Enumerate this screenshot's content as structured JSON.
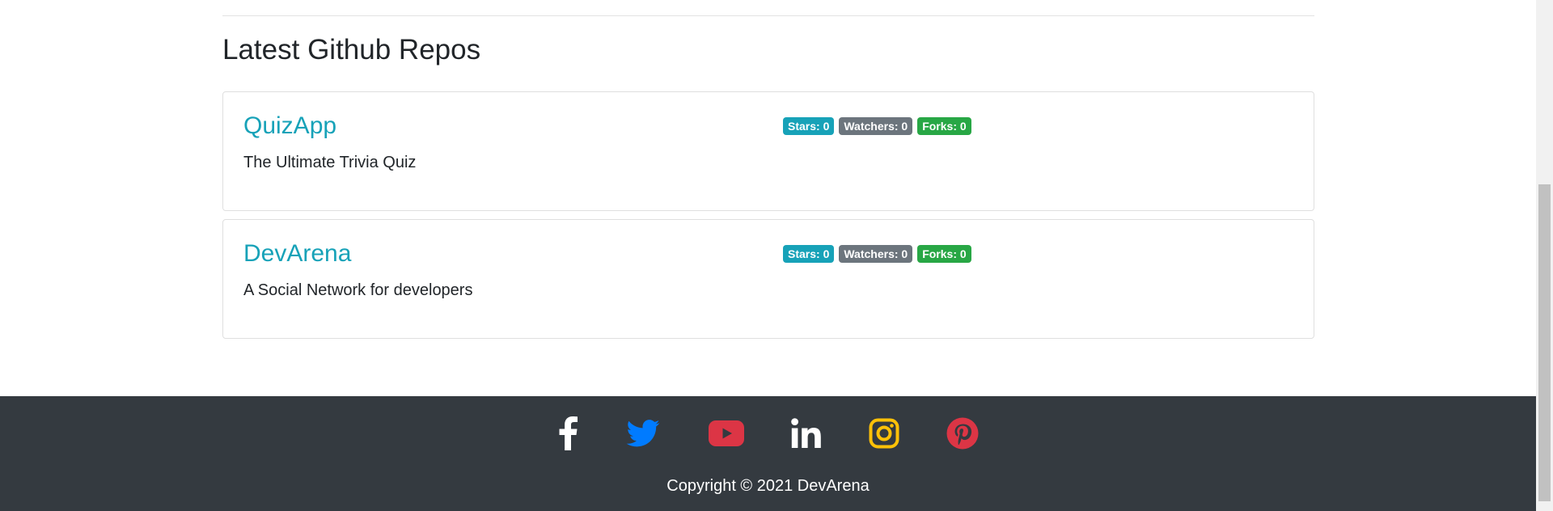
{
  "section": {
    "title": "Latest Github Repos"
  },
  "repos": [
    {
      "name": "QuizApp",
      "description": "The Ultimate Trivia Quiz",
      "stars": "Stars: 0",
      "watchers": "Watchers: 0",
      "forks": "Forks: 0"
    },
    {
      "name": "DevArena",
      "description": "A Social Network for developers",
      "stars": "Stars: 0",
      "watchers": "Watchers: 0",
      "forks": "Forks: 0"
    }
  ],
  "footer": {
    "copyright": "Copyright © 2021 DevArena",
    "social": [
      {
        "icon": "facebook-icon",
        "color": "#ffffff"
      },
      {
        "icon": "twitter-icon",
        "color": "#007bff"
      },
      {
        "icon": "youtube-icon",
        "color": "#dc3545"
      },
      {
        "icon": "linkedin-icon",
        "color": "#ffffff"
      },
      {
        "icon": "instagram-icon",
        "color": "#ffc107"
      },
      {
        "icon": "pinterest-icon",
        "color": "#dc3545"
      }
    ]
  },
  "colors": {
    "accent": "#17a2b8",
    "secondary": "#6c757d",
    "success": "#28a745",
    "footer_bg": "#343a40"
  }
}
